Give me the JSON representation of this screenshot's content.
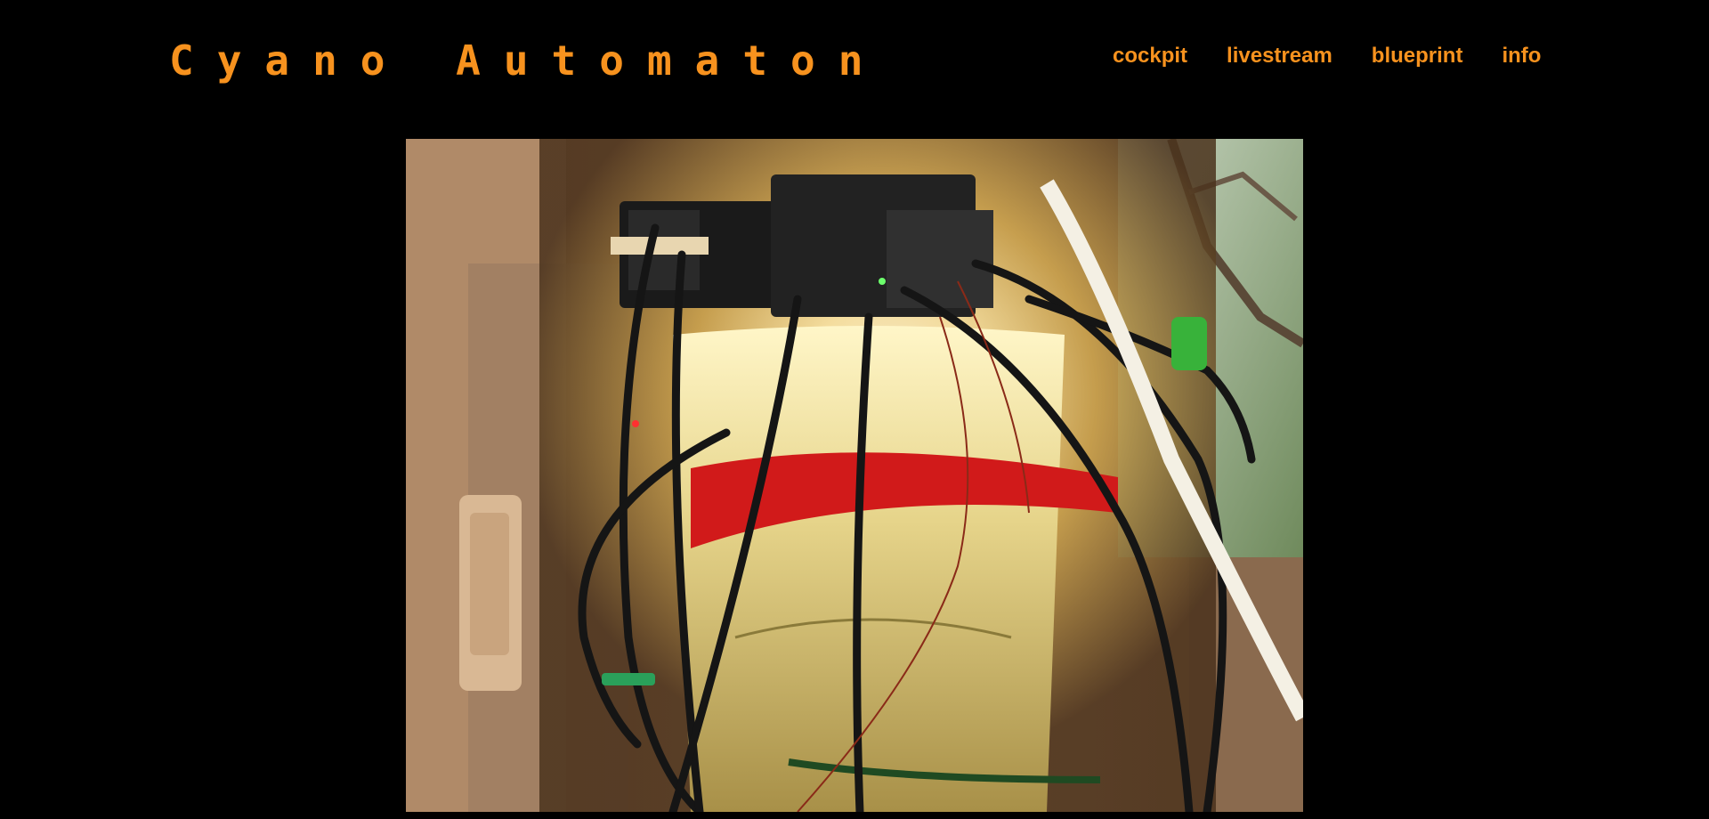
{
  "header": {
    "logo_text": "Cyano Automaton"
  },
  "nav": {
    "items": [
      {
        "label": "cockpit"
      },
      {
        "label": "livestream"
      },
      {
        "label": "blueprint"
      },
      {
        "label": "info"
      }
    ]
  },
  "colors": {
    "background": "#000000",
    "accent": "#f7921e"
  },
  "livestream": {
    "image_description_icon": "webcam-photo"
  }
}
